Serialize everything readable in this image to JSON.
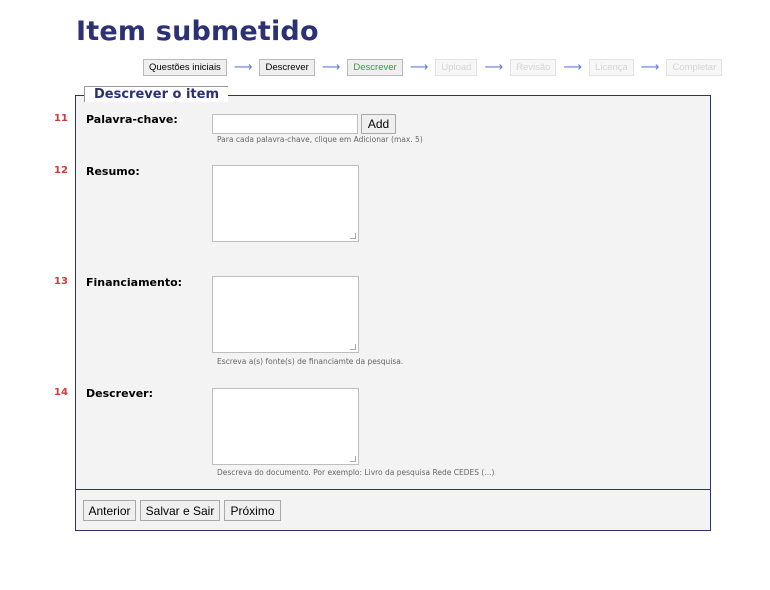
{
  "page": {
    "title": "Item submetido"
  },
  "steps": [
    {
      "label": "Questões iniciais",
      "state": "done"
    },
    {
      "label": "Descrever",
      "state": "done"
    },
    {
      "label": "Descrever",
      "state": "current"
    },
    {
      "label": "Upload",
      "state": "disabled"
    },
    {
      "label": "Revisão",
      "state": "disabled"
    },
    {
      "label": "Licença",
      "state": "disabled"
    },
    {
      "label": "Completar",
      "state": "disabled"
    }
  ],
  "section": {
    "legend": "Descrever o item"
  },
  "fields": {
    "keyword": {
      "number": "11",
      "label": "Palavra-chave:",
      "value": "",
      "add_label": "Add",
      "hint": "Para cada palavra-chave, clique em Adicionar (max. 5)"
    },
    "abstract": {
      "number": "12",
      "label": "Resumo:",
      "value": ""
    },
    "funding": {
      "number": "13",
      "label": "Financiamento:",
      "value": "",
      "hint": "Escreva a(s) fonte(s) de financiamte da pesquisa."
    },
    "description": {
      "number": "14",
      "label": "Descrever:",
      "value": "",
      "hint": "Descreva do documento. Por exemplo: Livro da pesquisa Rede CEDES (...)"
    }
  },
  "buttons": {
    "previous": "Anterior",
    "save_exit": "Salvar e Sair",
    "next": "Próximo"
  },
  "colors": {
    "title": "#2b3173",
    "number": "#d23a3a",
    "current_step": "#29a429",
    "arrow": "#5c80d8",
    "panel": "#f3f3f3"
  }
}
